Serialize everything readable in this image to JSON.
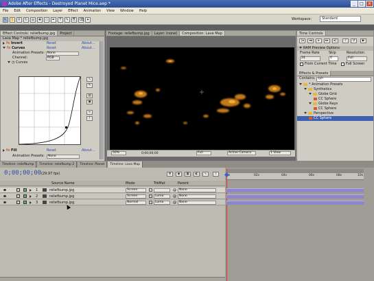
{
  "window": {
    "title": "Adobe After Effects - Destroyed Planet Mice.aep *"
  },
  "menu": [
    "File",
    "Edit",
    "Composition",
    "Layer",
    "Effect",
    "Animation",
    "View",
    "Window",
    "Help"
  ],
  "workspace": {
    "label": "Workspace:",
    "value": "Standard"
  },
  "left_panel": {
    "tabs": [
      "Effect Controls: reliefbump.jpg",
      "Project"
    ],
    "header": "Lava Map * reliefbump.jpg",
    "effects": [
      {
        "name": "Invert",
        "reset": "Reset",
        "about": "About..."
      },
      {
        "name": "Curves",
        "reset": "Reset",
        "about": "About..."
      }
    ],
    "animation_presets_label": "Animation Presets:",
    "animation_presets_value": "None",
    "channel_label": "Channel:",
    "channel_value": "RGB",
    "curves_label": "Curves",
    "fill": {
      "name": "Fill",
      "reset": "Reset",
      "about": "About..."
    },
    "fill_presets_label": "Animation Presets:",
    "fill_presets_value": "None"
  },
  "comp_panel": {
    "tabs": [
      "Footage: reliefbump.jpg",
      "Layer: (none)",
      "Composition: Lava Map"
    ],
    "footer": {
      "zoom": "50%",
      "time": "0;00;00;00",
      "resolution": "Full",
      "camera": "Active Camera",
      "view": "1 View"
    }
  },
  "time_controls": {
    "title": "Time Controls",
    "ram_preview": "RAM Preview Options",
    "frame_rate_label": "Frame Rate",
    "skip_label": "Skip",
    "resolution_label": "Resolution",
    "frame_rate": "24",
    "skip": "0",
    "resolution": "Full",
    "from_current_time": "From Current Time",
    "full_screen": "Full Screen"
  },
  "effects_presets": {
    "title": "Effects & Presets",
    "contains_label": "Contains:",
    "search": "sph",
    "tree": [
      {
        "label": "* Animation Presets",
        "indent": 0,
        "kind": "folder"
      },
      {
        "label": "Synthetics",
        "indent": 1,
        "kind": "folder"
      },
      {
        "label": "Globe Grid",
        "indent": 2,
        "kind": "folder"
      },
      {
        "label": "CC Sphere",
        "indent": 3,
        "kind": "fx"
      },
      {
        "label": "Globe Rays",
        "indent": 2,
        "kind": "folder"
      },
      {
        "label": "CC Sphere",
        "indent": 3,
        "kind": "fx"
      },
      {
        "label": "Perspective",
        "indent": 1,
        "kind": "folder"
      },
      {
        "label": "CC Sphere",
        "indent": 2,
        "kind": "fx",
        "selected": true
      }
    ]
  },
  "timeline": {
    "tabs": [
      "Timeline: reliefbump",
      "Timeline: reliefbump 2",
      "Timeline: Planet",
      "Timeline: Lava Map"
    ],
    "timecode": "0;00;00;00",
    "fps": "(29.97 fps)",
    "columns": {
      "source": "Source Name",
      "mode": "Mode",
      "trkmat": "TrkMat",
      "parent": "Parent"
    },
    "layers": [
      {
        "num": "1",
        "name": "reliefbump.jpg",
        "mode": "Screen",
        "trkmat": "",
        "parent": "None"
      },
      {
        "num": "2",
        "name": "reliefbump.jpg",
        "mode": "Screen",
        "trkmat": "Luma",
        "parent": "None"
      },
      {
        "num": "3",
        "name": "reliefbump.jpg",
        "mode": "Normal",
        "trkmat": "Luma",
        "parent": "None"
      }
    ],
    "ruler": [
      "0s",
      "02s",
      "04s",
      "06s",
      "08s",
      "10s"
    ]
  }
}
